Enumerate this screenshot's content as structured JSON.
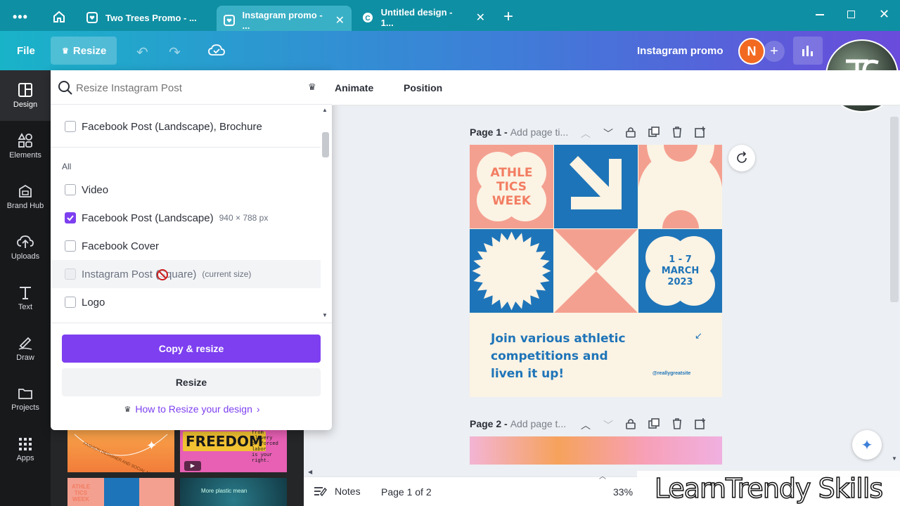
{
  "browser": {
    "tabs": [
      {
        "title": "Two Trees Promo - ..."
      },
      {
        "title": "Instagram promo - ..."
      },
      {
        "title": "Untitled design - 1..."
      }
    ]
  },
  "toolbar": {
    "file_label": "File",
    "resize_label": "Resize",
    "doc_title": "Instagram promo",
    "avatar_letter": "N"
  },
  "leftnav": {
    "items": [
      {
        "label": "Design"
      },
      {
        "label": "Elements"
      },
      {
        "label": "Brand Hub"
      },
      {
        "label": "Uploads"
      },
      {
        "label": "Text"
      },
      {
        "label": "Draw"
      },
      {
        "label": "Projects"
      },
      {
        "label": "Apps"
      }
    ]
  },
  "resize_panel": {
    "search_placeholder": "Resize Instagram Post",
    "top_item": "Facebook Post (Landscape), Brochure",
    "section_label": "All",
    "items": [
      {
        "label": "Video",
        "checked": false,
        "note": ""
      },
      {
        "label": "Facebook Post (Landscape)",
        "checked": true,
        "note": "940 × 788 px"
      },
      {
        "label": "Facebook Cover",
        "checked": false,
        "note": ""
      },
      {
        "label": "Instagram Post (Square)",
        "checked": false,
        "note": "(current size)"
      },
      {
        "label": "Logo",
        "checked": false,
        "note": ""
      }
    ],
    "copy_resize_label": "Copy & resize",
    "resize_label": "Resize",
    "help_link": "How to Resize your design"
  },
  "editor": {
    "animate_label": "Animate",
    "position_label": "Position",
    "page1_label": "Page 1 -",
    "page1_title_placeholder": "Add page ti...",
    "page2_label": "Page 2 -",
    "page2_title_placeholder": "Add page t...",
    "notes_label": "Notes",
    "page_counter": "Page 1 of 2",
    "zoom": "33%"
  },
  "design": {
    "headline": [
      "ATHLE",
      "TICS",
      "WEEK"
    ],
    "dates": [
      "1 - 7",
      "MARCH",
      "2023"
    ],
    "tagline": [
      "Join various athletic",
      "competitions and",
      "liven it up!"
    ],
    "handle": "@reallygreatsite"
  },
  "thumbnails": {
    "freedom_title": "FREEDOM",
    "freedom_text": [
      "from",
      "slavery",
      "or forced",
      "labor",
      "is your",
      "right."
    ],
    "thumb_athletics": [
      "ATHLE",
      "TICS",
      "WEEK"
    ],
    "thumb_curve_text": "FASHION DESIGNER AND SOCIAL MEDIA MANAGER",
    "thumb_plastic_text": "More plastic mean"
  },
  "watermark": "LearnTrendy Skills",
  "colors": {
    "accent_purple": "#7d3ff0",
    "design_blue": "#1e74b8",
    "design_salmon": "#f4a090",
    "design_cream": "#fbf3e4"
  }
}
